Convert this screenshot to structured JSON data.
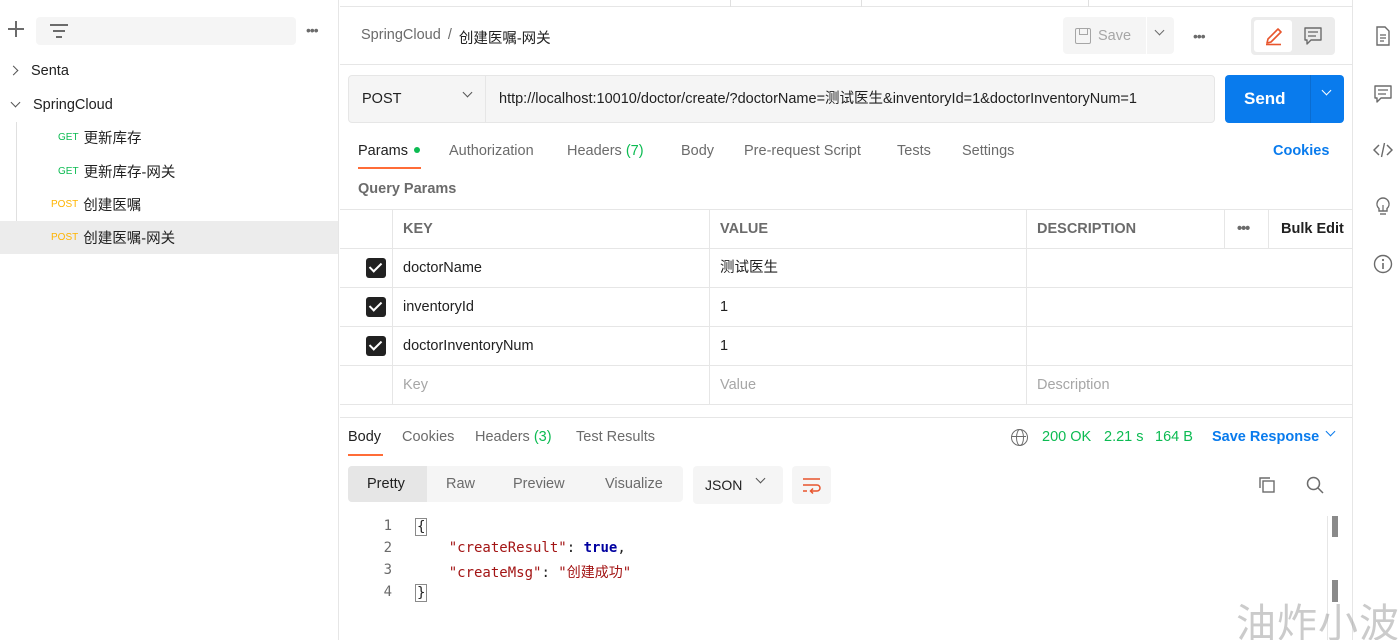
{
  "sidebar": {
    "tree": [
      {
        "label": "Senta",
        "expanded": false
      },
      {
        "label": "SpringCloud",
        "expanded": true
      },
      {
        "method": "GET",
        "label": "更新库存"
      },
      {
        "method": "GET",
        "label": "更新库存-网关"
      },
      {
        "method": "POST",
        "label": "创建医嘱"
      },
      {
        "method": "POST",
        "label": "创建医嘱-网关",
        "selected": true
      }
    ],
    "more_icon": "ellipsis-icon",
    "add_icon": "plus-icon",
    "filter_icon": "filter-icon"
  },
  "header": {
    "breadcrumb": {
      "collection": "SpringCloud",
      "separator": "/",
      "request": "创建医嘱-网关"
    },
    "save_label": "Save"
  },
  "request": {
    "method": "POST",
    "url": "http://localhost:10010/doctor/create/?doctorName=测试医生&inventoryId=1&doctorInventoryNum=1",
    "send_label": "Send",
    "tabs": [
      {
        "label": "Params",
        "active": true,
        "dot": true
      },
      {
        "label": "Authorization"
      },
      {
        "label": "Headers",
        "count": "(7)"
      },
      {
        "label": "Body"
      },
      {
        "label": "Pre-request Script"
      },
      {
        "label": "Tests"
      },
      {
        "label": "Settings"
      }
    ],
    "cookies_label": "Cookies",
    "query_params_title": "Query Params"
  },
  "params": {
    "headers": {
      "key": "KEY",
      "value": "VALUE",
      "description": "DESCRIPTION",
      "bulk_edit": "Bulk Edit"
    },
    "rows": [
      {
        "checked": true,
        "key": "doctorName",
        "value": "测试医生",
        "description": ""
      },
      {
        "checked": true,
        "key": "inventoryId",
        "value": "1",
        "description": ""
      },
      {
        "checked": true,
        "key": "doctorInventoryNum",
        "value": "1",
        "description": ""
      }
    ],
    "placeholders": {
      "key": "Key",
      "value": "Value",
      "description": "Description"
    }
  },
  "response": {
    "tabs": [
      {
        "label": "Body",
        "active": true
      },
      {
        "label": "Cookies"
      },
      {
        "label": "Headers",
        "count": "(3)"
      },
      {
        "label": "Test Results"
      }
    ],
    "status": "200 OK",
    "time": "2.21 s",
    "size": "164 B",
    "save_response_label": "Save Response",
    "views": [
      "Pretty",
      "Raw",
      "Preview",
      "Visualize"
    ],
    "format": "JSON",
    "code_lines": [
      {
        "n": "1",
        "text": "{"
      },
      {
        "n": "2",
        "key": "\"createResult\"",
        "value": "true",
        "comma": ","
      },
      {
        "n": "3",
        "key": "\"createMsg\"",
        "value": "\"创建成功\"",
        "comma": ""
      },
      {
        "n": "4",
        "text": "}"
      }
    ]
  },
  "colors": {
    "accent": "#097bed",
    "tab_active": "#ff6c37",
    "ok": "#0cbb52",
    "post": "#ffb400"
  },
  "watermark": "油炸小波"
}
